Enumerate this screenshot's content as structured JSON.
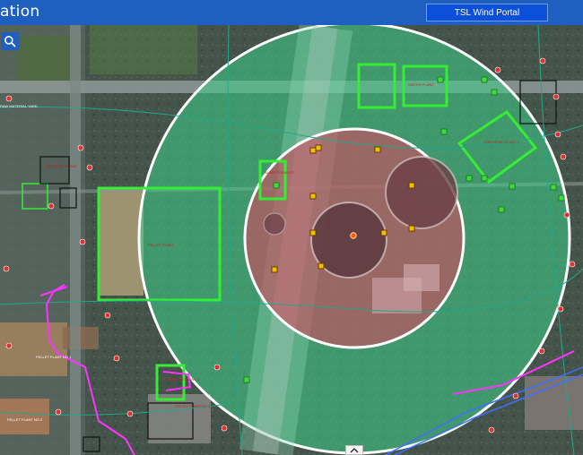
{
  "header": {
    "title": "ation",
    "portal_button_label": "TSL Wind Portal"
  },
  "icons": {
    "search": "search-icon",
    "collapse": "chevron-up-icon"
  },
  "colors": {
    "header_bar": "#1f5fbf",
    "outer_buffer_zone": "#3fcf8a",
    "inner_buffer_zone": "#d04a60",
    "source_marker": "#ff5a00",
    "receptor_marker": "#f0c000",
    "facility_outline": "#33ee33",
    "pipeline": "#ff33ff"
  },
  "map_labels": {
    "label_1": "SINTERING PLANT",
    "label_2": "PELLET PLANT",
    "label_3": "SINTERING PLANT 2",
    "label_4": "BLAST FURNACE",
    "label_5": "PELLET PLANT NO 1",
    "label_6": "PELLET PLANT NO 2",
    "label_7": "SINTERING PLANT 3",
    "label_8": "PELLET PLANT NO 3",
    "label_9": "SINTER PLANT",
    "label_10": "RAW MATERIAL YARD"
  }
}
